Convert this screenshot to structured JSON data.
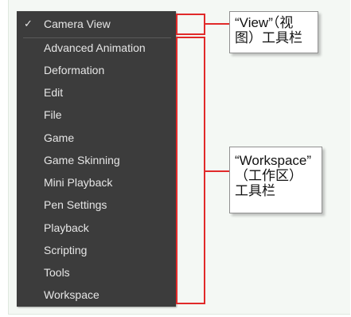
{
  "menu": {
    "checked_label": "Camera View",
    "checkmark": "✓",
    "items": [
      "Advanced Animation",
      "Deformation",
      "Edit",
      "File",
      "Game",
      "Game Skinning",
      "Mini Playback",
      "Pen Settings",
      "Playback",
      "Scripting",
      "Tools",
      "Workspace"
    ]
  },
  "callouts": {
    "view": {
      "line1": "“View”（视",
      "line2": "图）工具栏"
    },
    "workspace": {
      "line1": "“Workspace”",
      "line2": "（工作区）",
      "line3": "工具栏"
    }
  },
  "colors": {
    "menu_bg": "#3c3c3c",
    "menu_text": "#e6e6e6",
    "annotation_red": "#e12a2a",
    "panel_bg": "#f4f8f4"
  }
}
